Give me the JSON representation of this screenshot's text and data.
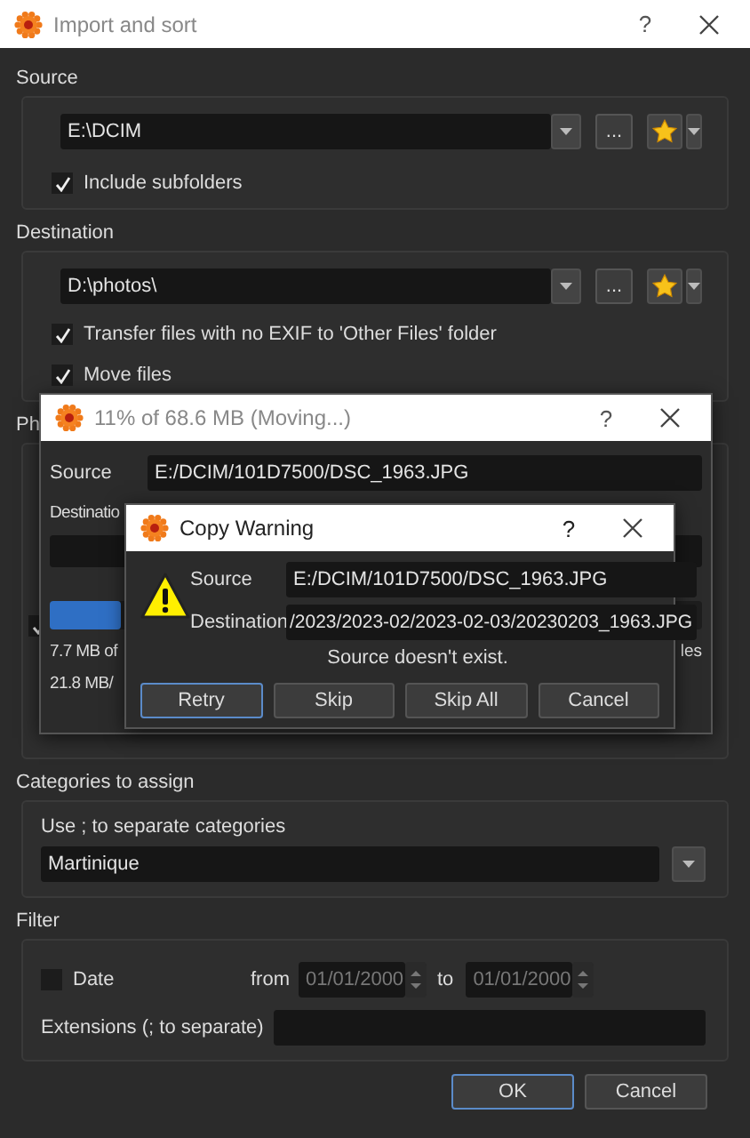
{
  "window": {
    "title": "Import and sort",
    "help": "?"
  },
  "source": {
    "label": "Source",
    "path": "E:\\DCIM",
    "browse": "...",
    "options": [
      {
        "label": "Include subfolders",
        "checked": true
      }
    ]
  },
  "destination": {
    "label": "Destination",
    "path": "D:\\photos\\",
    "browse": "...",
    "options": [
      {
        "label": "Transfer files with no EXIF to 'Other Files' folder",
        "checked": true
      },
      {
        "label": "Move files",
        "checked": true
      }
    ]
  },
  "photos_section": {
    "label": "Ph",
    "option": {
      "checked": true
    }
  },
  "categories": {
    "label": "Categories to assign",
    "hint": "Use ; to separate categories",
    "value": "Martinique"
  },
  "filter": {
    "label": "Filter",
    "date": {
      "label": "Date",
      "checked": false
    },
    "from_label": "from",
    "from": "01/01/2000",
    "to_label": "to",
    "to": "01/01/2000",
    "extensions_label": "Extensions (; to separate)"
  },
  "buttons": [
    {
      "label": "OK",
      "selected": true
    },
    {
      "label": "Cancel",
      "selected": false
    }
  ],
  "progress_dialog": {
    "title": "11% of 68.6 MB (Moving...)",
    "help": "?",
    "source_label": "Source",
    "source": "E:/DCIM/101D7500/DSC_1963.JPG",
    "destination_label": "Destinatio",
    "level": 0.11,
    "size_text": "7.7 MB of",
    "speed_text": "21.8 MB/",
    "side_text": "les"
  },
  "copy_warning": {
    "title": "Copy Warning",
    "help": "?",
    "source_label": "Source",
    "source": "E:/DCIM/101D7500/DSC_1963.JPG",
    "destination_label": "Destination",
    "destination": "/2023/2023-02/2023-02-03/20230203_1963.JPG",
    "message": "Source doesn't exist.",
    "buttons": [
      {
        "label": "Retry",
        "selected": true
      },
      {
        "label": "Skip",
        "selected": false
      },
      {
        "label": "Skip All",
        "selected": false
      },
      {
        "label": "Cancel",
        "selected": false
      }
    ]
  }
}
